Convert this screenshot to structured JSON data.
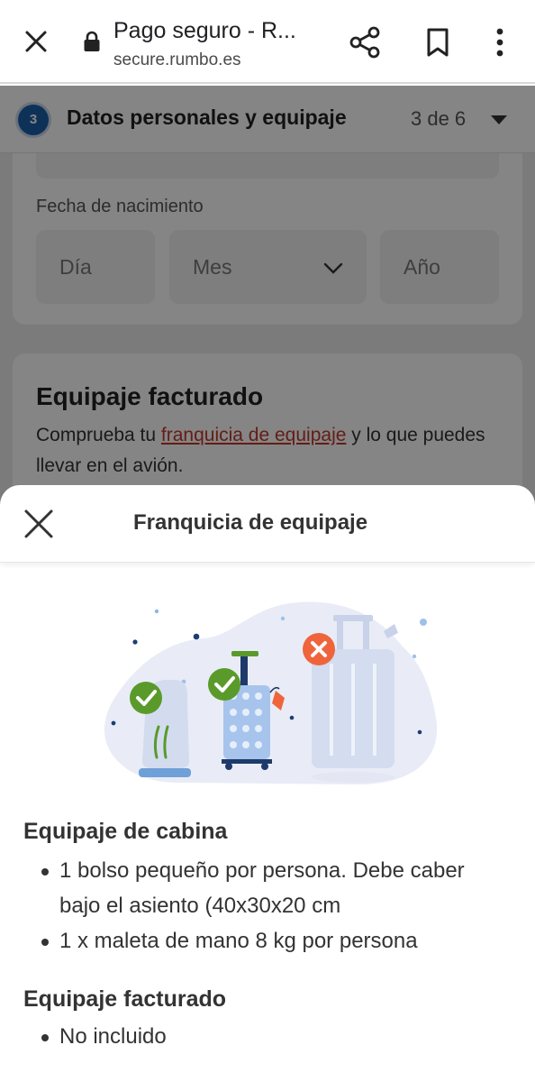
{
  "browser": {
    "title": "Pago seguro - R...",
    "url": "secure.rumbo.es"
  },
  "page": {
    "step": {
      "number": "3",
      "title": "Datos personales y equipaje",
      "count": "3 de 6"
    },
    "birthdate": {
      "label": "Fecha de nacimiento",
      "day_placeholder": "Día",
      "month_placeholder": "Mes",
      "year_placeholder": "Año"
    },
    "checked_baggage": {
      "heading": "Equipaje facturado",
      "desc_before": "Comprueba tu ",
      "desc_link": "franquicia de equipaje",
      "desc_after": " y lo que puedes llevar en el avión."
    }
  },
  "sheet": {
    "title": "Franquicia de equipaje",
    "cabin": {
      "title": "Equipaje de cabina",
      "items": [
        "1 bolso pequeño por persona. Debe caber bajo el asiento (40x30x20 cm",
        "1 x maleta de mano 8 kg por persona"
      ]
    },
    "checked": {
      "title": "Equipaje facturado",
      "items": [
        "No incluido"
      ]
    }
  },
  "colors": {
    "accent_blue": "#1b5fa8",
    "link_red": "#c0392b",
    "check_green": "#5a9a2a",
    "cross_red": "#f0643c"
  },
  "icons": [
    "close-icon",
    "lock-icon",
    "share-icon",
    "bookmark-icon",
    "more-vert-icon",
    "chevron-down-icon"
  ]
}
